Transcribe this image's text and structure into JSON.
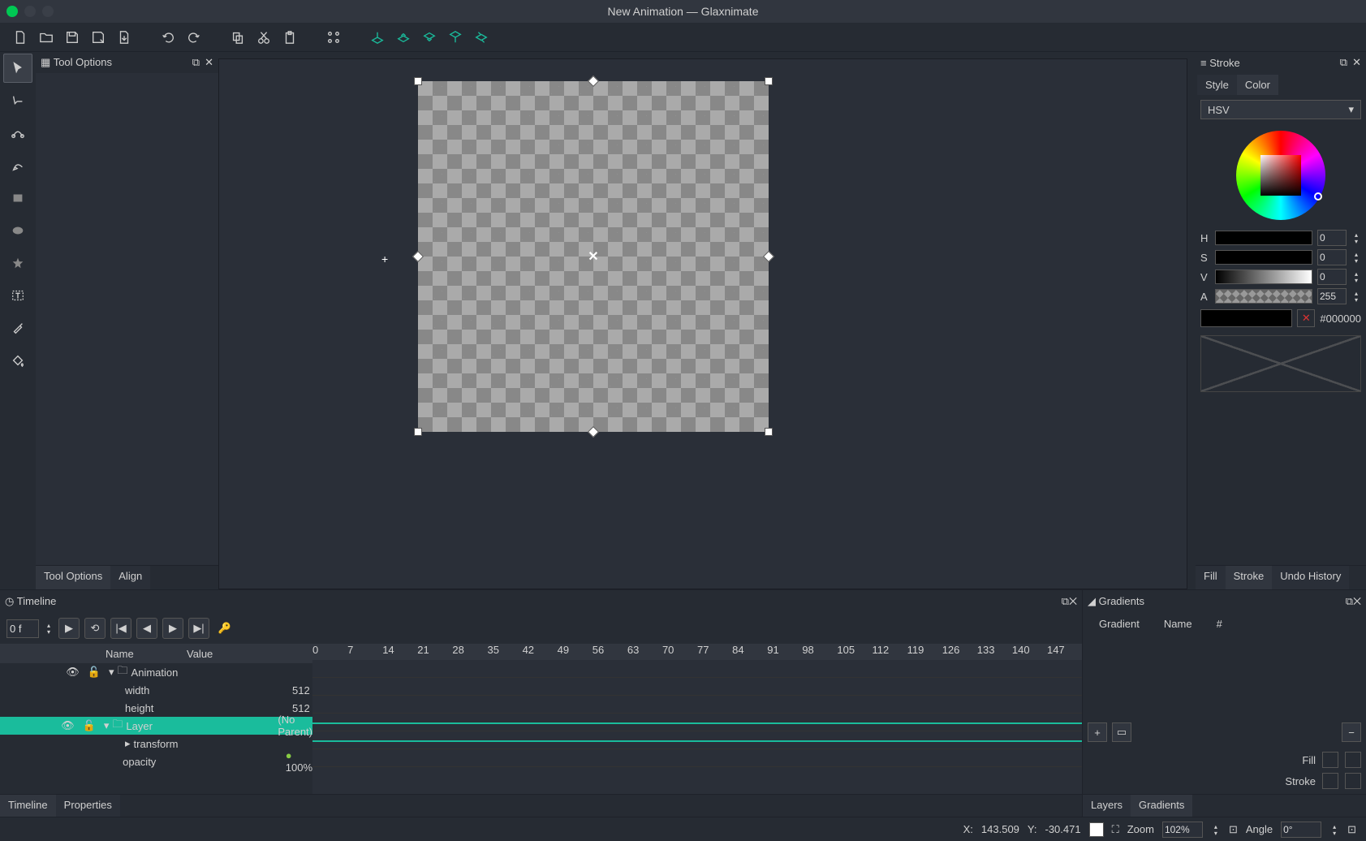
{
  "title": "New Animation — Glaxnimate",
  "panels": {
    "tool_options": "Tool Options",
    "align": "Align",
    "stroke": "Stroke",
    "fill": "Fill",
    "undo_history": "Undo History",
    "timeline": "Timeline",
    "properties": "Properties",
    "layers": "Layers",
    "gradients": "Gradients"
  },
  "stroke_tabs": {
    "style": "Style",
    "color": "Color"
  },
  "color_model": "HSV",
  "hsv": {
    "h_label": "H",
    "s_label": "S",
    "v_label": "V",
    "a_label": "A",
    "h": "0",
    "s": "0",
    "v": "0",
    "a": "255",
    "hex": "#000000"
  },
  "gradients_cols": {
    "gradient": "Gradient",
    "name": "Name",
    "count": "#"
  },
  "gradients_labels": {
    "fill": "Fill",
    "stroke": "Stroke"
  },
  "timeline": {
    "frame": "0 f",
    "cols": {
      "name": "Name",
      "value": "Value"
    },
    "ruler": [
      "0",
      "7",
      "14",
      "21",
      "28",
      "35",
      "42",
      "49",
      "56",
      "63",
      "70",
      "77",
      "84",
      "91",
      "98",
      "105",
      "112",
      "119",
      "126",
      "133",
      "140",
      "147"
    ],
    "rows": [
      {
        "name": "Animation",
        "value": "",
        "indent": 0,
        "expand": true,
        "folder": true,
        "vis": true,
        "lock": true
      },
      {
        "name": "width",
        "value": "512",
        "indent": 1
      },
      {
        "name": "height",
        "value": "512",
        "indent": 1
      },
      {
        "name": "Layer",
        "value": "(No Parent)",
        "indent": 0,
        "expand": true,
        "folder": true,
        "selected": true,
        "vis": true,
        "lock": true
      },
      {
        "name": "transform",
        "value": "",
        "indent": 1,
        "caret": true
      },
      {
        "name": "opacity",
        "value": "100%",
        "indent": 1,
        "dot": true
      }
    ]
  },
  "status": {
    "x_label": "X:",
    "x": "143.509",
    "y_label": "Y:",
    "y": "-30.471",
    "zoom_label": "Zoom",
    "zoom": "102%",
    "angle_label": "Angle",
    "angle": "0°"
  }
}
